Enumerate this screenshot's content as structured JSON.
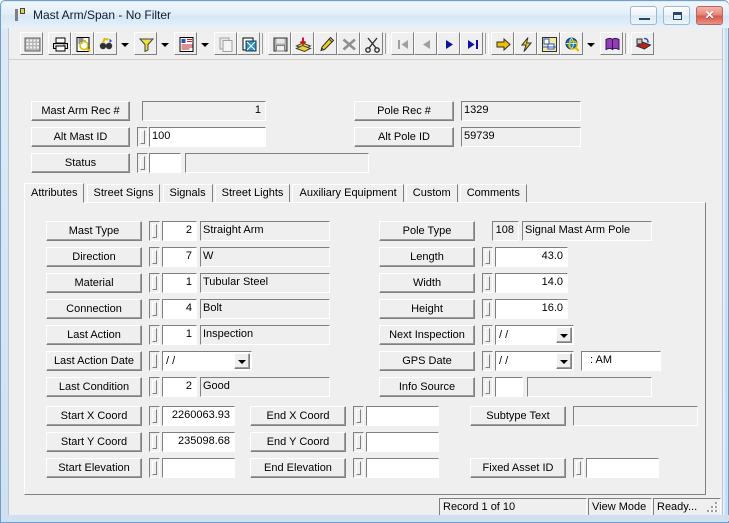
{
  "window": {
    "title": "Mast Arm/Span - No Filter",
    "app_icon": "document-bar-icon",
    "buttons": {
      "minimize": "minimize-icon",
      "maximize": "maximize-icon",
      "close": "✕"
    }
  },
  "toolbar": {
    "items": [
      {
        "name": "grid-view-icon",
        "tooltip": "Grid View"
      },
      {
        "name": "print-icon",
        "tooltip": "Print"
      },
      {
        "name": "print-preview-icon",
        "tooltip": "Print Preview"
      },
      {
        "name": "find-icon",
        "tooltip": "Find"
      },
      {
        "name": "find-dropdown-arrow",
        "tooltip": "Find Options"
      },
      {
        "name": "filter-funnel-icon",
        "tooltip": "Filter"
      },
      {
        "name": "filter-dropdown-arrow",
        "tooltip": "Filter Options"
      },
      {
        "name": "report-icon",
        "tooltip": "Report"
      },
      {
        "name": "report-dropdown-arrow",
        "tooltip": "Report Options"
      },
      {
        "name": "copy-record-icon",
        "tooltip": "Copy Record"
      },
      {
        "name": "paste-record-icon",
        "tooltip": "Paste Record"
      },
      {
        "name": "save-disk-icon",
        "tooltip": "Save"
      },
      {
        "name": "add-record-icon",
        "tooltip": "Add Record"
      },
      {
        "name": "edit-pencil-icon",
        "tooltip": "Edit Record"
      },
      {
        "name": "cancel-x-icon",
        "tooltip": "Cancel"
      },
      {
        "name": "cut-scissors-icon",
        "tooltip": "Delete"
      },
      {
        "name": "first-record-icon",
        "tooltip": "First Record"
      },
      {
        "name": "previous-record-icon",
        "tooltip": "Previous Record"
      },
      {
        "name": "next-record-icon",
        "tooltip": "Next Record"
      },
      {
        "name": "last-record-icon",
        "tooltip": "Last Record"
      },
      {
        "name": "goto-arrow-icon",
        "tooltip": "Go To"
      },
      {
        "name": "lightning-icon",
        "tooltip": "Quick Action"
      },
      {
        "name": "map-layers-icon",
        "tooltip": "Map"
      },
      {
        "name": "globe-search-icon",
        "tooltip": "Locate"
      },
      {
        "name": "globe-dropdown-arrow",
        "tooltip": "Locate Options"
      },
      {
        "name": "book-icon",
        "tooltip": "Help Book"
      },
      {
        "name": "export-icon",
        "tooltip": "Export"
      }
    ]
  },
  "header": {
    "mast_arm_rec": {
      "label": "Mast Arm Rec #",
      "value": "1"
    },
    "alt_mast_id": {
      "label": "Alt Mast ID",
      "value": "100"
    },
    "status": {
      "label": "Status",
      "code": "",
      "text": ""
    },
    "pole_rec": {
      "label": "Pole Rec #",
      "value": "1329"
    },
    "alt_pole_id": {
      "label": "Alt Pole ID",
      "value": "59739"
    }
  },
  "tabs": [
    {
      "label": "Attributes",
      "active": true
    },
    {
      "label": "Street Signs",
      "active": false
    },
    {
      "label": "Signals",
      "active": false
    },
    {
      "label": "Street Lights",
      "active": false
    },
    {
      "label": "Auxiliary Equipment",
      "active": false
    },
    {
      "label": "Custom",
      "active": false
    },
    {
      "label": "Comments",
      "active": false
    }
  ],
  "attributes": {
    "left": [
      {
        "label": "Mast Type",
        "code": "2",
        "text": "Straight Arm"
      },
      {
        "label": "Direction",
        "code": "7",
        "text": "W"
      },
      {
        "label": "Material",
        "code": "1",
        "text": "Tubular Steel"
      },
      {
        "label": "Connection",
        "code": "4",
        "text": "Bolt"
      },
      {
        "label": "Last Action",
        "code": "1",
        "text": "Inspection"
      },
      {
        "label": "Last Action Date",
        "date": "/  /"
      },
      {
        "label": "Last Condition",
        "code": "2",
        "text": "Good"
      }
    ],
    "right": [
      {
        "label": "Pole Type",
        "code": "108",
        "text": "Signal Mast Arm Pole"
      },
      {
        "label": "Length",
        "value": "43.0"
      },
      {
        "label": "Width",
        "value": "14.0"
      },
      {
        "label": "Height",
        "value": "16.0"
      },
      {
        "label": "Next Inspection",
        "date": "/  /"
      },
      {
        "label": "GPS Date",
        "date": "/  /",
        "time": ":   AM"
      },
      {
        "label": "Info Source",
        "code": "",
        "text": ""
      }
    ],
    "coords": {
      "start_x": {
        "label": "Start X Coord",
        "value": "2260063.93"
      },
      "start_y": {
        "label": "Start Y Coord",
        "value": "235098.68"
      },
      "start_elev": {
        "label": "Start Elevation",
        "value": ""
      },
      "end_x": {
        "label": "End X Coord",
        "value": ""
      },
      "end_y": {
        "label": "End Y Coord",
        "value": ""
      },
      "end_elev": {
        "label": "End Elevation",
        "value": ""
      },
      "subtype_text": {
        "label": "Subtype Text",
        "value": ""
      },
      "fixed_asset_id": {
        "label": "Fixed Asset ID",
        "value": ""
      }
    }
  },
  "statusbar": {
    "record": "Record 1 of 10",
    "mode": "View Mode",
    "state": "Ready..."
  }
}
